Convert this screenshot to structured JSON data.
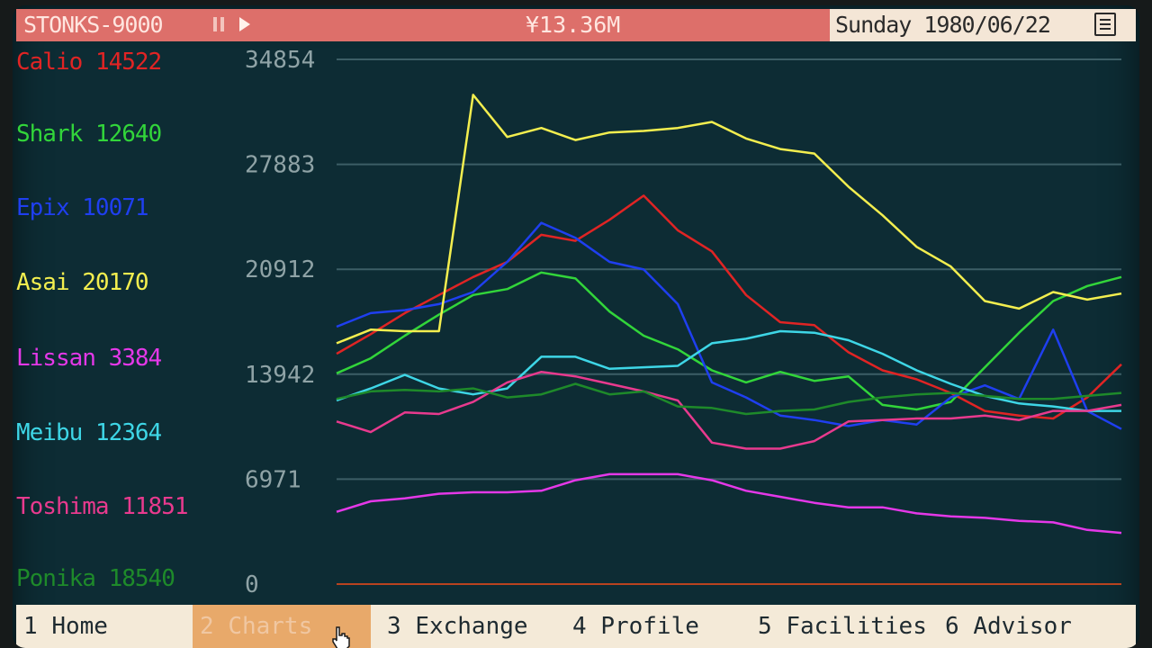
{
  "topbar": {
    "title": "STONKS-9000",
    "money": "¥13.36M",
    "date": "Sunday 1980/06/22",
    "icons": [
      "pause-icon",
      "play-icon",
      "menu-icon"
    ]
  },
  "legend": [
    {
      "name": "Calio",
      "value": "14522",
      "color": "#e02424"
    },
    {
      "name": "Shark",
      "value": "12640",
      "color": "#32d53a"
    },
    {
      "name": "Epix",
      "value": "10071",
      "color": "#1f3ff0"
    },
    {
      "name": "Asai",
      "value": "20170",
      "color": "#f3ee4f"
    },
    {
      "name": "Lissan",
      "value": "3384",
      "color": "#e438e8"
    },
    {
      "name": "Meibu",
      "value": "12364",
      "color": "#3ed6e6"
    },
    {
      "name": "Toshima",
      "value": "11851",
      "color": "#e83a8e"
    },
    {
      "name": "Ponika",
      "value": "18540",
      "color": "#1e8a2a"
    }
  ],
  "navbar": [
    {
      "key": "1",
      "label": "Home",
      "active": false
    },
    {
      "key": "2",
      "label": "Charts",
      "active": true
    },
    {
      "key": "3",
      "label": "Exchange",
      "active": false
    },
    {
      "key": "4",
      "label": "Profile",
      "active": false
    },
    {
      "key": "5",
      "label": "Facilities",
      "active": false
    },
    {
      "key": "6",
      "label": "Advisor",
      "active": false
    }
  ],
  "chart_data": {
    "type": "line",
    "ylim": [
      0,
      34854
    ],
    "yticks": [
      "0",
      "6971",
      "13942",
      "20912",
      "27883",
      "34854"
    ],
    "grid": true,
    "axis_color": "#b8431f",
    "series": [
      {
        "name": "Calio",
        "color": "#e02424",
        "values": [
          15300,
          16600,
          18000,
          19200,
          20400,
          21400,
          23200,
          22800,
          24200,
          25800,
          23500,
          22100,
          19200,
          17400,
          17200,
          15400,
          14200,
          13600,
          12700,
          11500,
          11200,
          11000,
          12400,
          14600
        ]
      },
      {
        "name": "Shark",
        "color": "#32d53a",
        "values": [
          14000,
          15000,
          16500,
          17900,
          19200,
          19600,
          20700,
          20300,
          18100,
          16500,
          15600,
          14200,
          13400,
          14100,
          13500,
          13800,
          11900,
          11600,
          12100,
          14400,
          16700,
          18800,
          19800,
          20400
        ]
      },
      {
        "name": "Epix",
        "color": "#1f3ff0",
        "values": [
          17100,
          18000,
          18200,
          18600,
          19400,
          21400,
          24000,
          23000,
          21400,
          20900,
          18600,
          13400,
          12400,
          11200,
          10900,
          10500,
          10900,
          10600,
          12400,
          13200,
          12300,
          16900,
          11500,
          10300
        ]
      },
      {
        "name": "Asai",
        "color": "#f3ee4f",
        "values": [
          16000,
          16900,
          16800,
          16800,
          32500,
          29700,
          30300,
          29500,
          30000,
          30100,
          30300,
          30700,
          29600,
          28900,
          28600,
          26400,
          24500,
          22400,
          21100,
          18800,
          18300,
          19400,
          18900,
          19300
        ]
      },
      {
        "name": "Lissan",
        "color": "#e438e8",
        "values": [
          4800,
          5500,
          5700,
          6000,
          6100,
          6100,
          6200,
          6900,
          7300,
          7300,
          7300,
          6900,
          6200,
          5800,
          5400,
          5100,
          5100,
          4700,
          4500,
          4400,
          4200,
          4100,
          3600,
          3400
        ]
      },
      {
        "name": "Meibu",
        "color": "#3ed6e6",
        "values": [
          12200,
          13000,
          13900,
          13000,
          12600,
          13000,
          15100,
          15100,
          14300,
          14400,
          14500,
          16000,
          16300,
          16800,
          16700,
          16200,
          15300,
          14200,
          13300,
          12500,
          12000,
          11800,
          11500,
          11500
        ]
      },
      {
        "name": "Toshima",
        "color": "#e83a8e",
        "values": [
          10800,
          10100,
          11400,
          11300,
          12100,
          13400,
          14100,
          13800,
          13300,
          12800,
          12200,
          9400,
          9000,
          9000,
          9500,
          10800,
          10900,
          11000,
          11000,
          11200,
          10900,
          11500,
          11500,
          11900
        ]
      },
      {
        "name": "Ponika",
        "color": "#1e8a2a",
        "values": [
          12300,
          12800,
          12900,
          12800,
          13000,
          12400,
          12600,
          13300,
          12600,
          12800,
          11800,
          11700,
          11300,
          11500,
          11600,
          12100,
          12400,
          12600,
          12700,
          12500,
          12300,
          12300,
          12500,
          12700
        ]
      }
    ]
  }
}
